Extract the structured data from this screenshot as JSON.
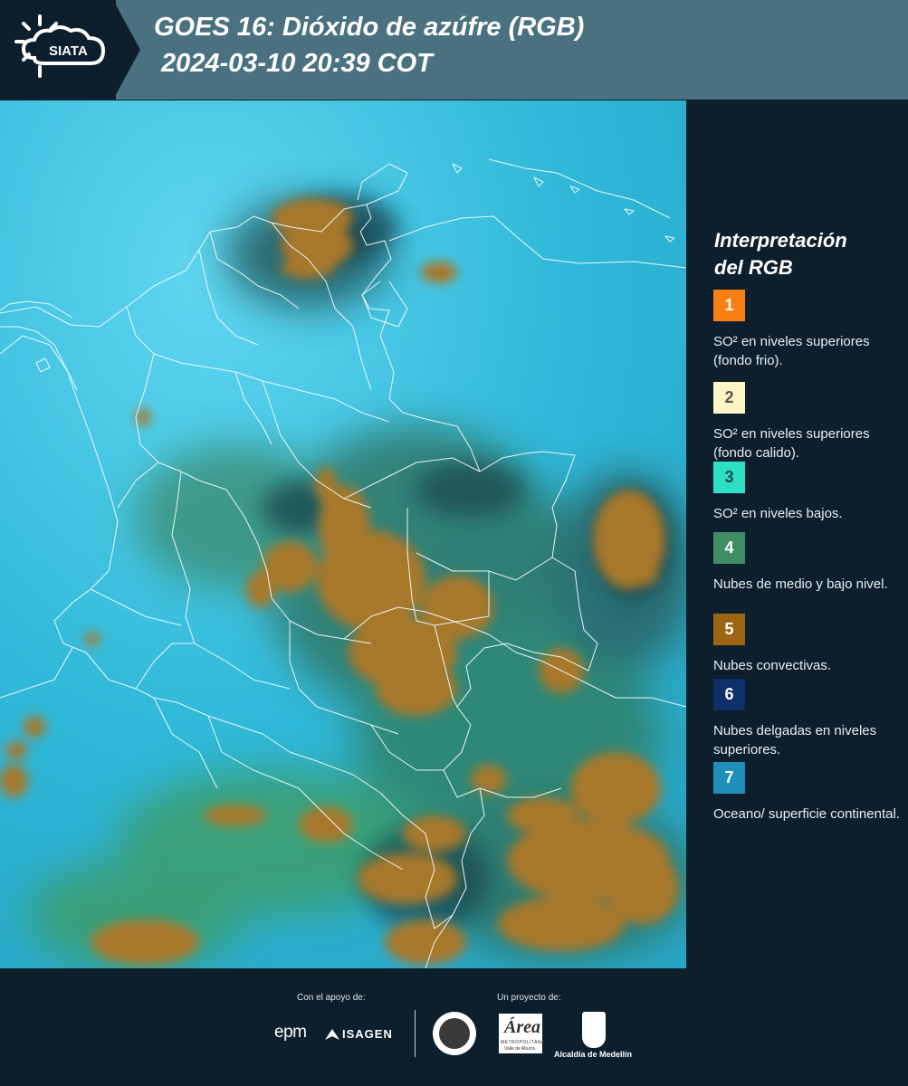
{
  "header": {
    "logo_text": "SIATA",
    "title_line1": "GOES 16: Dióxido de azúfre (RGB)",
    "title_line2": "2024-03-10 20:39 COT"
  },
  "legend": {
    "title_line1": "Interpretación",
    "title_line2": "del RGB",
    "items": [
      {
        "number": "1",
        "color": "#f77f13",
        "text_color": "#ffffff",
        "label": "SO² en niveles superiores (fondo frio)."
      },
      {
        "number": "2",
        "color": "#fff5c2",
        "text_color": "#555555",
        "label": "SO² en niveles superiores (fondo calido)."
      },
      {
        "number": "3",
        "color": "#2ee0c3",
        "text_color": "#1a4a44",
        "label": "SO² en niveles bajos."
      },
      {
        "number": "4",
        "color": "#3e8d63",
        "text_color": "#ffffff",
        "label": "Nubes de medio y bajo nivel."
      },
      {
        "number": "5",
        "color": "#9b6513",
        "text_color": "#ffffff",
        "label": "Nubes convectivas."
      },
      {
        "number": "6",
        "color": "#0e2f6a",
        "text_color": "#ffffff",
        "label": "Nubes delgadas en niveles superiores."
      },
      {
        "number": "7",
        "color": "#1d8fb8",
        "text_color": "#ffffff",
        "label": "Oceano/ superficie continental."
      }
    ]
  },
  "footer": {
    "support_label": "Con el apoyo de:",
    "project_label": "Un proyecto de:",
    "sponsor_epm": "epm",
    "sponsor_isagen": "ISAGEN",
    "area_name": "Área",
    "area_sub1": "METROPOLITANA",
    "area_sub2": "Valle de Aburrá",
    "alcaldia": "Alcaldía de Medellín"
  }
}
